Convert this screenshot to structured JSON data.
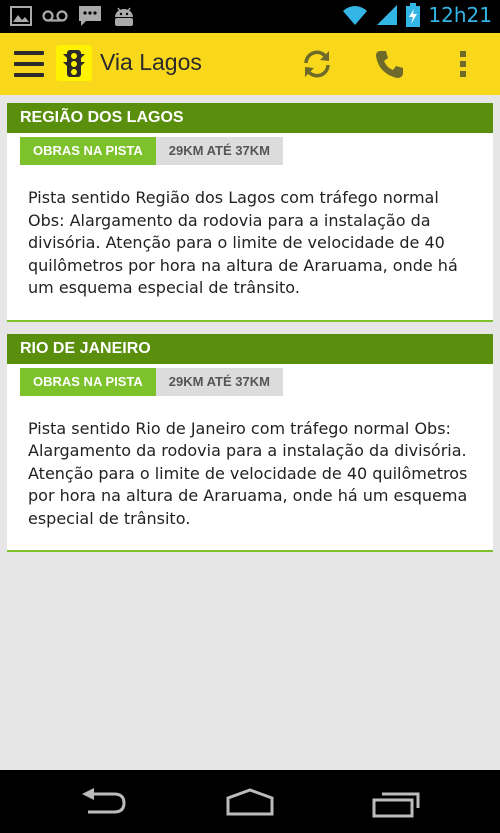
{
  "status_bar": {
    "time": "12h21",
    "icons": [
      "image-icon",
      "voicemail-icon",
      "chat-icon",
      "android-icon",
      "wifi-icon",
      "signal-icon",
      "battery-charging-icon"
    ]
  },
  "action_bar": {
    "title": "Via Lagos",
    "icons": [
      "menu-icon",
      "traffic-light-icon",
      "refresh-icon",
      "phone-icon",
      "overflow-icon"
    ],
    "accent_color": "#f9d71a"
  },
  "cards": [
    {
      "region": "REGIÃO DOS LAGOS",
      "type": "OBRAS NA PISTA",
      "km": "29KM ATÉ 37KM",
      "text": "Pista sentido Região dos Lagos com tráfego normal Obs: Alargamento da rodovia para a instalação da divisória. Atenção para o limite de velocidade de 40 quilômetros por hora na altura de Araruama, onde há um esquema especial de trânsito."
    },
    {
      "region": "RIO DE JANEIRO",
      "type": "OBRAS NA PISTA",
      "km": "29KM ATÉ 37KM",
      "text": "Pista sentido Rio de Janeiro com tráfego normal Obs: Alargamento da rodovia  para a instalação da divisória. Atenção para o limite de velocidade de 40 quilômetros por hora na altura de Araruama, onde há um esquema especial de trânsito."
    }
  ],
  "nav_bar": {
    "icons": [
      "back-icon",
      "home-icon",
      "recents-icon"
    ]
  },
  "colors": {
    "header_green": "#5a8f0d",
    "tag_green": "#7dc12b",
    "tag_gray": "#dcdcdc",
    "background": "#e6e6e6"
  }
}
